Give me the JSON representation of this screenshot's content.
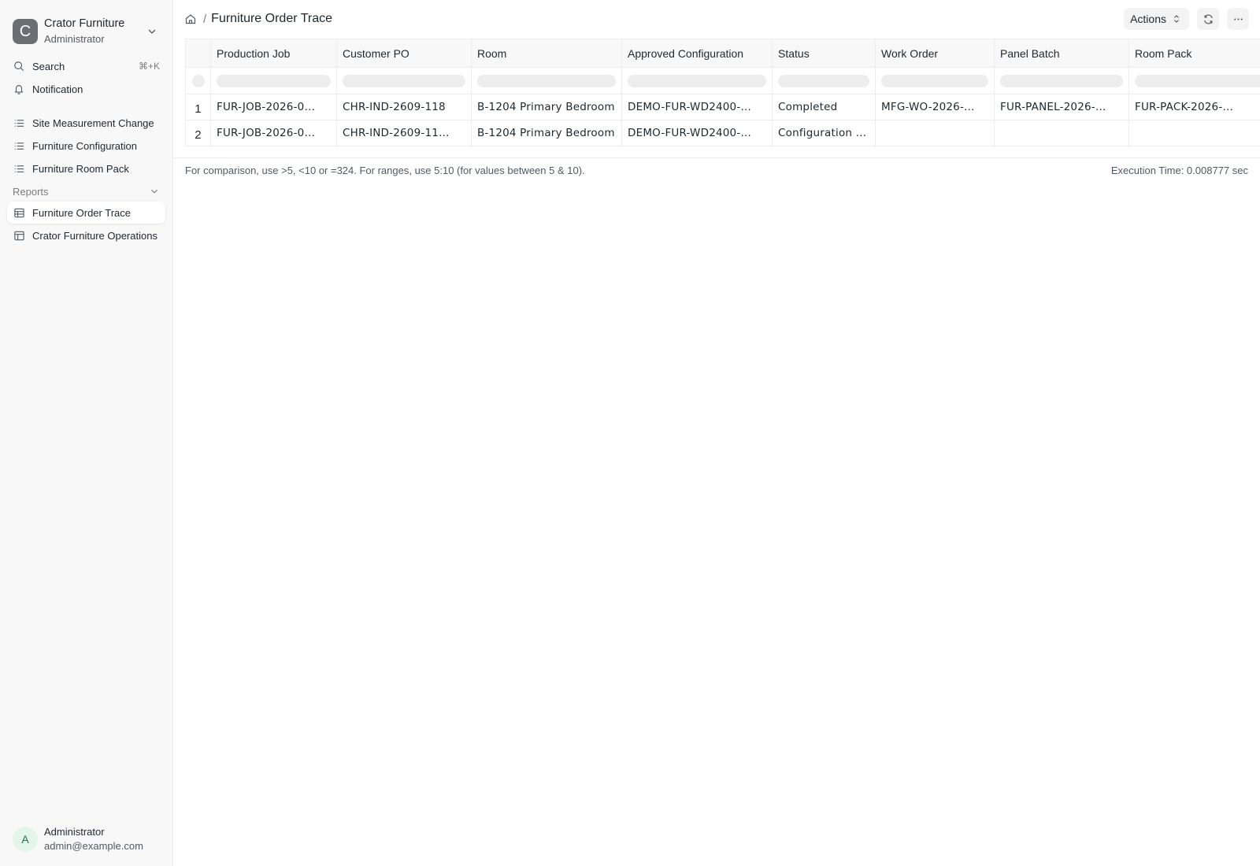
{
  "workspace": {
    "initial": "C",
    "name": "Crator Furniture",
    "role": "Administrator"
  },
  "nav": {
    "search": {
      "label": "Search",
      "shortcut": "⌘+K"
    },
    "notification": {
      "label": "Notification"
    },
    "items": [
      {
        "label": "Site Measurement Change"
      },
      {
        "label": "Furniture Configuration"
      },
      {
        "label": "Furniture Room Pack"
      }
    ],
    "reports_section": "Reports",
    "reports": [
      {
        "label": "Furniture Order Trace",
        "active": true
      },
      {
        "label": "Crator Furniture Operations"
      }
    ]
  },
  "user": {
    "initial": "A",
    "name": "Administrator",
    "email": "admin@example.com"
  },
  "breadcrumb": {
    "title": "Furniture Order Trace"
  },
  "toolbar": {
    "actions_label": "Actions"
  },
  "table": {
    "columns": [
      "Production Job",
      "Customer PO",
      "Room",
      "Approved Configuration",
      "Status",
      "Work Order",
      "Panel Batch",
      "Room Pack"
    ],
    "rows": [
      {
        "index": "1",
        "cells": [
          "FUR-JOB-2026-0…",
          "CHR-IND-2609-118",
          "B-1204 Primary Bedroom",
          "DEMO-FUR-WD2400-…",
          "Completed",
          "MFG-WO-2026-…",
          "FUR-PANEL-2026-…",
          "FUR-PACK-2026-…"
        ]
      },
      {
        "index": "2",
        "cells": [
          "FUR-JOB-2026-0…",
          "CHR-IND-2609-11…",
          "B-1204 Primary Bedroom",
          "DEMO-FUR-WD2400-…",
          "Configuration H…",
          "",
          "",
          ""
        ]
      }
    ]
  },
  "footer": {
    "hint": "For comparison, use >5, <10 or =324. For ranges, use 5:10 (for values between 5 & 10).",
    "execution_time": "Execution Time: 0.008777 sec"
  }
}
